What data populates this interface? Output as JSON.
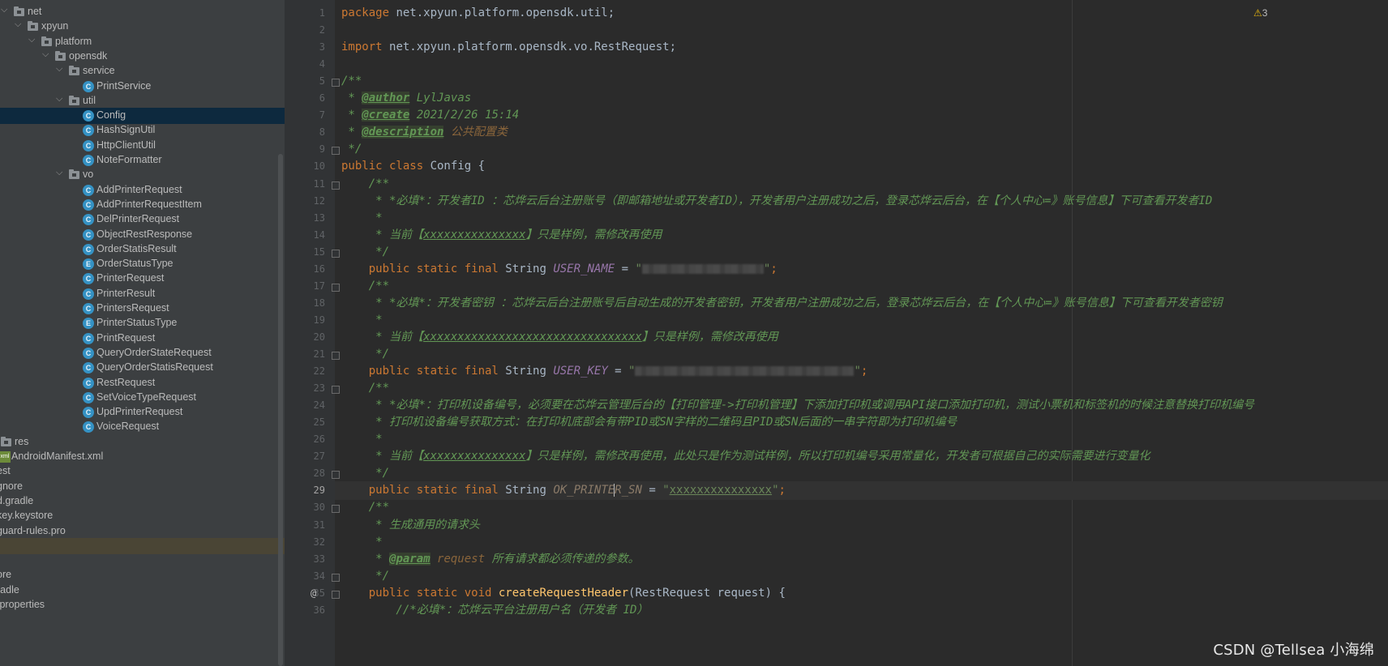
{
  "project_tree": {
    "items": [
      {
        "label": "net",
        "kind": "folder",
        "depth": 0,
        "arrow": "v"
      },
      {
        "label": "xpyun",
        "kind": "folder",
        "depth": 1,
        "arrow": "v"
      },
      {
        "label": "platform",
        "kind": "folder",
        "depth": 2,
        "arrow": "v"
      },
      {
        "label": "opensdk",
        "kind": "folder",
        "depth": 3,
        "arrow": "v"
      },
      {
        "label": "service",
        "kind": "folder",
        "depth": 4,
        "arrow": "v"
      },
      {
        "label": "PrintService",
        "kind": "class",
        "depth": 5
      },
      {
        "label": "util",
        "kind": "folder",
        "depth": 4,
        "arrow": "v"
      },
      {
        "label": "Config",
        "kind": "class",
        "depth": 5,
        "selected": true
      },
      {
        "label": "HashSignUtil",
        "kind": "class",
        "depth": 5
      },
      {
        "label": "HttpClientUtil",
        "kind": "class",
        "depth": 5
      },
      {
        "label": "NoteFormatter",
        "kind": "class",
        "depth": 5
      },
      {
        "label": "vo",
        "kind": "folder",
        "depth": 4,
        "arrow": "v"
      },
      {
        "label": "AddPrinterRequest",
        "kind": "class",
        "depth": 5
      },
      {
        "label": "AddPrinterRequestItem",
        "kind": "class",
        "depth": 5
      },
      {
        "label": "DelPrinterRequest",
        "kind": "class",
        "depth": 5
      },
      {
        "label": "ObjectRestResponse",
        "kind": "class",
        "depth": 5
      },
      {
        "label": "OrderStatisResult",
        "kind": "class",
        "depth": 5
      },
      {
        "label": "OrderStatusType",
        "kind": "enum",
        "depth": 5
      },
      {
        "label": "PrinterRequest",
        "kind": "class",
        "depth": 5
      },
      {
        "label": "PrinterResult",
        "kind": "class",
        "depth": 5
      },
      {
        "label": "PrintersRequest",
        "kind": "class",
        "depth": 5
      },
      {
        "label": "PrinterStatusType",
        "kind": "enum",
        "depth": 5
      },
      {
        "label": "PrintRequest",
        "kind": "class",
        "depth": 5
      },
      {
        "label": "QueryOrderStateRequest",
        "kind": "class",
        "depth": 5
      },
      {
        "label": "QueryOrderStatisRequest",
        "kind": "class",
        "depth": 5
      },
      {
        "label": "RestRequest",
        "kind": "class",
        "depth": 5
      },
      {
        "label": "SetVoiceTypeRequest",
        "kind": "class",
        "depth": 5
      },
      {
        "label": "UpdPrinterRequest",
        "kind": "class",
        "depth": 5
      },
      {
        "label": "VoiceRequest",
        "kind": "class",
        "depth": 5
      },
      {
        "label": "res",
        "kind": "folder",
        "depth": -1
      },
      {
        "label": "AndroidManifest.xml",
        "kind": "xml",
        "depth": -1
      },
      {
        "label": "est",
        "kind": "plain",
        "depth": -2
      },
      {
        "label": "gnore",
        "kind": "plain",
        "depth": -2
      },
      {
        "label": "d.gradle",
        "kind": "plain",
        "depth": -2
      },
      {
        "label": "key.keystore",
        "kind": "plain",
        "depth": -2
      },
      {
        "label": "guard-rules.pro",
        "kind": "plain",
        "depth": -2
      },
      {
        "label": "",
        "kind": "plain",
        "depth": -2,
        "highlight": true
      },
      {
        "label": "",
        "kind": "plain",
        "depth": -2
      },
      {
        "label": "ore",
        "kind": "plain",
        "depth": -2
      },
      {
        "label": "radle",
        "kind": "plain",
        "depth": -2
      },
      {
        "label": ".properties",
        "kind": "plain",
        "depth": -2
      }
    ]
  },
  "editor": {
    "current_line": 29,
    "warning_count": "3",
    "lines": [
      {
        "n": 1,
        "tokens": [
          [
            "kw",
            "package "
          ],
          [
            "cls",
            "net.xpyun.platform.opensdk.util;"
          ]
        ]
      },
      {
        "n": 2,
        "tokens": []
      },
      {
        "n": 3,
        "tokens": [
          [
            "kw",
            "import "
          ],
          [
            "cls",
            "net.xpyun.platform.opensdk.vo.RestRequest;"
          ]
        ]
      },
      {
        "n": 4,
        "tokens": []
      },
      {
        "n": 5,
        "fold": true,
        "tokens": [
          [
            "dc",
            "/**"
          ]
        ]
      },
      {
        "n": 6,
        "tokens": [
          [
            "dc",
            " * "
          ],
          [
            "tag",
            "@author"
          ],
          [
            "dc",
            " LylJavas"
          ]
        ]
      },
      {
        "n": 7,
        "tokens": [
          [
            "dc",
            " * "
          ],
          [
            "tag",
            "@create"
          ],
          [
            "dc",
            " 2021/2/26 15:14"
          ]
        ]
      },
      {
        "n": 8,
        "tokens": [
          [
            "dc",
            " * "
          ],
          [
            "tag",
            "@description"
          ],
          [
            "tagv",
            " 公共配置类"
          ]
        ]
      },
      {
        "n": 9,
        "fold": true,
        "tokens": [
          [
            "dc",
            " */"
          ]
        ]
      },
      {
        "n": 10,
        "tokens": [
          [
            "kw",
            "public class "
          ],
          [
            "cls",
            "Config {"
          ]
        ]
      },
      {
        "n": 11,
        "fold": true,
        "tokens": [
          [
            "dc",
            "    /**"
          ]
        ]
      },
      {
        "n": 12,
        "tokens": [
          [
            "dc",
            "     * *必填*：开发者ID ：芯烨云后台注册账号（即邮箱地址或开发者ID），开发者用户注册成功之后，登录芯烨云后台，在【个人中心=》账号信息】下可查看开发者ID"
          ]
        ]
      },
      {
        "n": 13,
        "tokens": [
          [
            "dc",
            "     *"
          ]
        ]
      },
      {
        "n": 14,
        "tokens": [
          [
            "dc",
            "     * 当前【"
          ],
          [
            "dcu",
            "xxxxxxxxxxxxxxx"
          ],
          [
            "dc",
            "】只是样例，需修改再使用"
          ]
        ]
      },
      {
        "n": 15,
        "fold": true,
        "tokens": [
          [
            "dc",
            "     */"
          ]
        ]
      },
      {
        "n": 16,
        "tokens": [
          [
            "kw",
            "    public static final "
          ],
          [
            "cls",
            "String "
          ],
          [
            "fld",
            "USER_NAME"
          ],
          [
            "cls",
            " = "
          ],
          [
            "str",
            "\""
          ],
          [
            "blur",
            "150"
          ],
          [
            "str",
            "\""
          ],
          [
            "kw",
            ";"
          ]
        ]
      },
      {
        "n": 17,
        "fold": true,
        "tokens": [
          [
            "dc",
            "    /**"
          ]
        ]
      },
      {
        "n": 18,
        "tokens": [
          [
            "dc",
            "     * *必填*：开发者密钥 ：芯烨云后台注册账号后自动生成的开发者密钥，开发者用户注册成功之后，登录芯烨云后台，在【个人中心=》账号信息】下可查看开发者密钥"
          ]
        ]
      },
      {
        "n": 19,
        "tokens": [
          [
            "dc",
            "     *"
          ]
        ]
      },
      {
        "n": 20,
        "tokens": [
          [
            "dc",
            "     * 当前【"
          ],
          [
            "dcu",
            "xxxxxxxxxxxxxxxxxxxxxxxxxxxxxxxx"
          ],
          [
            "dc",
            "】只是样例，需修改再使用"
          ]
        ]
      },
      {
        "n": 21,
        "fold": true,
        "tokens": [
          [
            "dc",
            "     */"
          ]
        ]
      },
      {
        "n": 22,
        "tokens": [
          [
            "kw",
            "    public static final "
          ],
          [
            "cls",
            "String "
          ],
          [
            "fld",
            "USER_KEY"
          ],
          [
            "cls",
            " = "
          ],
          [
            "str",
            "\""
          ],
          [
            "blur",
            "270"
          ],
          [
            "str",
            "\""
          ],
          [
            "kw",
            ";"
          ]
        ]
      },
      {
        "n": 23,
        "fold": true,
        "tokens": [
          [
            "dc",
            "    /**"
          ]
        ]
      },
      {
        "n": 24,
        "tokens": [
          [
            "dc",
            "     * *必填*：打印机设备编号，必须要在芯烨云管理后台的【打印管理->打印机管理】下添加打印机或调用API接口添加打印机，测试小票机和标签机的时候注意替换打印机编号"
          ]
        ]
      },
      {
        "n": 25,
        "tokens": [
          [
            "dc",
            "     * 打印机设备编号获取方式：在打印机底部会有带PID或SN字样的二维码且PID或SN后面的一串字符即为打印机编号"
          ]
        ]
      },
      {
        "n": 26,
        "tokens": [
          [
            "dc",
            "     *"
          ]
        ]
      },
      {
        "n": 27,
        "tokens": [
          [
            "dc",
            "     * 当前【"
          ],
          [
            "dcu",
            "xxxxxxxxxxxxxxx"
          ],
          [
            "dc",
            "】只是样例，需修改再使用，此处只是作为测试样例，所以打印机编号采用常量化，开发者可根据自己的实际需要进行变量化"
          ]
        ]
      },
      {
        "n": 28,
        "fold": true,
        "tokens": [
          [
            "dc",
            "     */"
          ]
        ]
      },
      {
        "n": 29,
        "tokens": [
          [
            "kw",
            "    public static final "
          ],
          [
            "cls",
            "String "
          ],
          [
            "fldu",
            "OK_PRINTE"
          ],
          [
            "caret",
            ""
          ],
          [
            "fldu",
            "R_SN"
          ],
          [
            "cls",
            " = "
          ],
          [
            "str",
            "\""
          ],
          [
            "stru",
            "xxxxxxxxxxxxxxx"
          ],
          [
            "str",
            "\""
          ],
          [
            "kw",
            ";"
          ]
        ]
      },
      {
        "n": 30,
        "fold": true,
        "tokens": [
          [
            "dc",
            "    /**"
          ]
        ]
      },
      {
        "n": 31,
        "tokens": [
          [
            "dc",
            "     * 生成通用的请求头"
          ]
        ]
      },
      {
        "n": 32,
        "tokens": [
          [
            "dc",
            "     *"
          ]
        ]
      },
      {
        "n": 33,
        "tokens": [
          [
            "dc",
            "     * "
          ],
          [
            "tag",
            "@param"
          ],
          [
            "tagv",
            " request"
          ],
          [
            "dc",
            " 所有请求都必须传递的参数。"
          ]
        ]
      },
      {
        "n": 34,
        "fold": true,
        "tokens": [
          [
            "dc",
            "     */"
          ]
        ]
      },
      {
        "n": 35,
        "mark": "@",
        "fold": true,
        "tokens": [
          [
            "kw",
            "    public static void "
          ],
          [
            "fn",
            "createRequestHeader"
          ],
          [
            "cls",
            "(RestRequest request) {"
          ]
        ]
      },
      {
        "n": 36,
        "tokens": [
          [
            "dc",
            "        //*必填*：芯烨云平台注册用户名（开发者 ID）"
          ]
        ]
      }
    ]
  },
  "watermark": "CSDN @Tellsea 小海绵"
}
